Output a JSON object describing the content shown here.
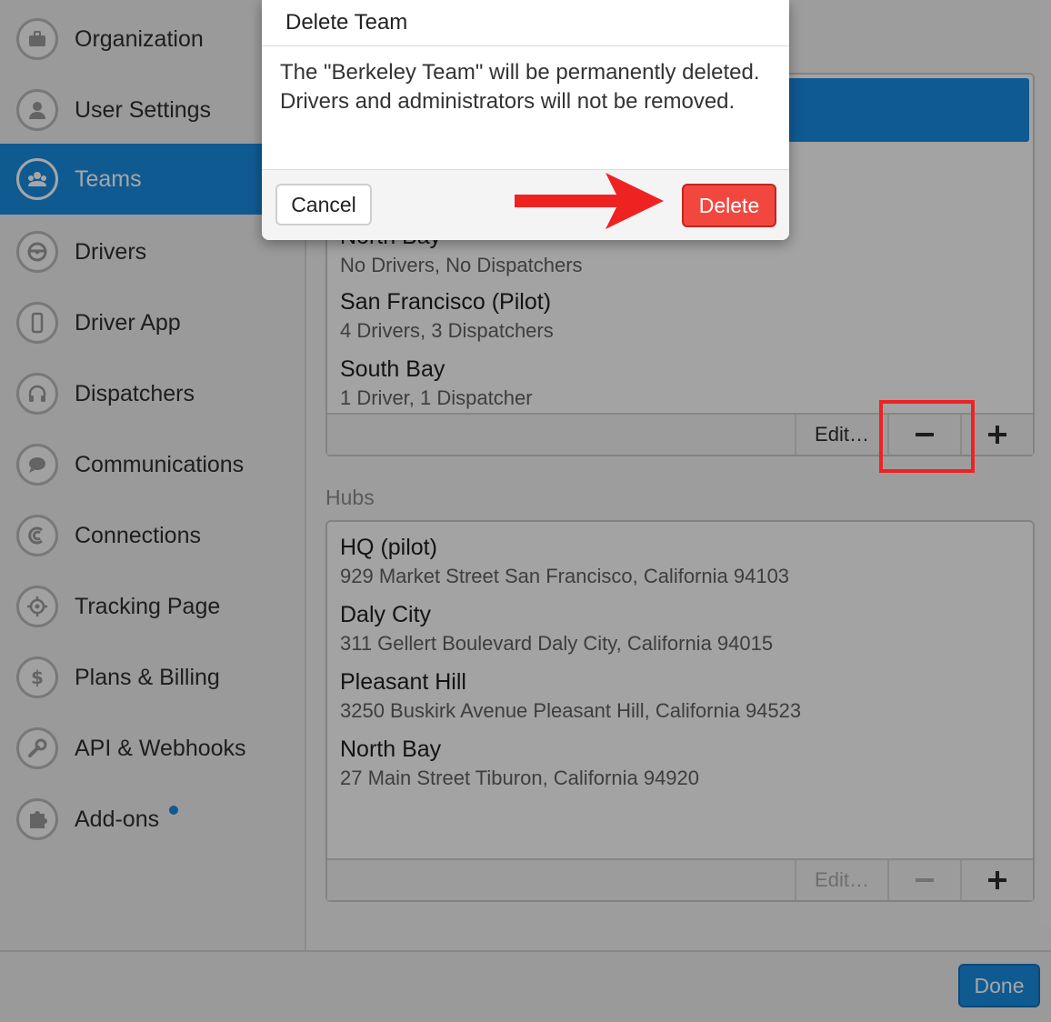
{
  "sidebar": {
    "items": [
      {
        "label": "Organization",
        "icon": "briefcase-icon"
      },
      {
        "label": "User Settings",
        "icon": "user-icon"
      },
      {
        "label": "Teams",
        "icon": "team-icon",
        "active": true
      },
      {
        "label": "Drivers",
        "icon": "steering-wheel-icon"
      },
      {
        "label": "Driver App",
        "icon": "phone-icon"
      },
      {
        "label": "Dispatchers",
        "icon": "headset-icon"
      },
      {
        "label": "Communications",
        "icon": "chat-bubble-icon"
      },
      {
        "label": "Connections",
        "icon": "connection-icon"
      },
      {
        "label": "Tracking Page",
        "icon": "crosshair-icon"
      },
      {
        "label": "Plans & Billing",
        "icon": "dollar-icon"
      },
      {
        "label": "API & Webhooks",
        "icon": "wrench-icon"
      },
      {
        "label": "Add-ons",
        "icon": "puzzle-icon",
        "badge": true
      }
    ]
  },
  "teams": {
    "items": [
      {
        "name": "North Bay",
        "detail": "No Drivers, No Dispatchers"
      },
      {
        "name": "San Francisco (Pilot)",
        "detail": "4 Drivers, 3 Dispatchers"
      },
      {
        "name": "South Bay",
        "detail": "1 Driver, 1 Dispatcher"
      }
    ],
    "toolbar": {
      "edit_label": "Edit…"
    }
  },
  "hubs": {
    "title": "Hubs",
    "items": [
      {
        "name": "HQ (pilot)",
        "address": "929 Market Street San Francisco, California 94103"
      },
      {
        "name": "Daly City",
        "address": "311 Gellert Boulevard Daly City, California 94015"
      },
      {
        "name": "Pleasant Hill",
        "address": "3250 Buskirk Avenue Pleasant Hill, California 94523"
      },
      {
        "name": "North Bay",
        "address": "27 Main Street Tiburon, California 94920"
      }
    ],
    "toolbar": {
      "edit_label": "Edit…"
    }
  },
  "footer": {
    "done_label": "Done"
  },
  "modal": {
    "title": "Delete Team",
    "body": "The \"Berkeley Team\" will be permanently deleted. Drivers and administrators will not be removed.",
    "cancel_label": "Cancel",
    "delete_label": "Delete"
  },
  "colors": {
    "accent": "#1a8be0",
    "danger": "#f2473f",
    "annotation": "#ef2222"
  }
}
